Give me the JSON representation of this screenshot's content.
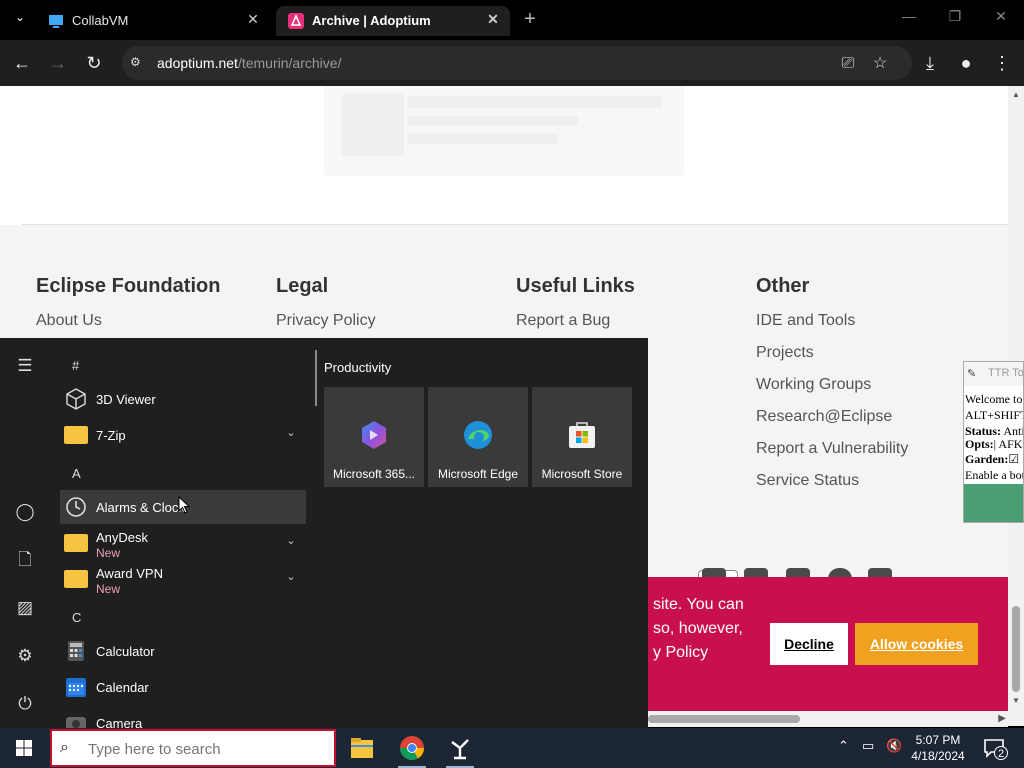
{
  "browser": {
    "tabs": [
      {
        "title": "CollabVM",
        "active": false
      },
      {
        "title": "Archive | Adoptium",
        "active": true
      }
    ],
    "new_tab": "+",
    "url_host": "adoptium.net",
    "url_path": "/temurin/archive/"
  },
  "footer": {
    "columns": [
      {
        "heading": "Eclipse Foundation",
        "links": [
          "About Us"
        ]
      },
      {
        "heading": "Legal",
        "links": [
          "Privacy Policy"
        ]
      },
      {
        "heading": "Useful Links",
        "links": [
          "Report a Bug"
        ]
      },
      {
        "heading": "Other",
        "links": [
          "IDE and Tools",
          "Projects",
          "Working Groups",
          "Research@Eclipse",
          "Report a Vulnerability",
          "Service Status"
        ]
      }
    ]
  },
  "cookie_banner": {
    "line1": "site. You can",
    "line2": "so, however,",
    "line3": "y Policy",
    "decline": "Decline",
    "allow": "Allow cookies",
    "color": "#c8104f",
    "allow_color": "#f0a11f"
  },
  "ttr": {
    "title": "TTR Too",
    "welcome": "Welcome to",
    "hotkey": "ALT+SHIFT+",
    "status_label": "Status:",
    "status_value": "Anti",
    "opts_label": "Opts:",
    "opts_value": "| AFK T",
    "garden_label": "Garden:",
    "garden_check": "☑",
    "enable": "Enable a bot"
  },
  "start_menu": {
    "hash_header": "#",
    "group_a": "A",
    "group_c": "C",
    "apps": [
      {
        "name": "3D Viewer",
        "icon": "cube-icon"
      },
      {
        "name": "7-Zip",
        "icon": "folder-icon"
      },
      {
        "name": "Alarms & Clock",
        "icon": "clock-icon"
      },
      {
        "name": "AnyDesk",
        "badge": "New",
        "icon": "folder-icon"
      },
      {
        "name": "Award VPN",
        "badge": "New",
        "icon": "folder-icon"
      },
      {
        "name": "Calculator",
        "icon": "calculator-icon"
      },
      {
        "name": "Calendar",
        "icon": "calendar-icon"
      },
      {
        "name": "Camera",
        "icon": "camera-icon"
      }
    ],
    "tiles_heading": "Productivity",
    "tiles": [
      {
        "label": "Microsoft 365...",
        "icon": "microsoft-365-icon"
      },
      {
        "label": "Microsoft Edge",
        "icon": "edge-icon"
      },
      {
        "label": "Microsoft Store",
        "icon": "store-icon"
      }
    ]
  },
  "taskbar": {
    "search_placeholder": "Type here to search",
    "time": "5:07 PM",
    "date": "4/18/2024",
    "notification_count": "2"
  }
}
